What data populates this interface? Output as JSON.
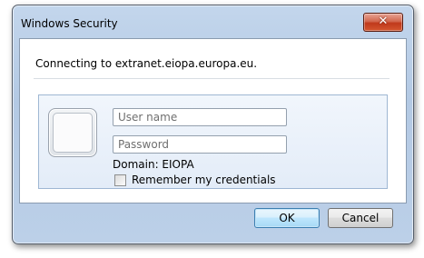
{
  "window": {
    "title": "Windows Security",
    "close_glyph": "✕"
  },
  "message": "Connecting to extranet.eiopa.europa.eu.",
  "credentials": {
    "username_placeholder": "User name",
    "password_placeholder": "Password",
    "domain_text": "Domain: EIOPA",
    "remember_label": "Remember my credentials",
    "remember_checked": false
  },
  "buttons": {
    "ok_label": "OK",
    "cancel_label": "Cancel"
  },
  "icons": {
    "user_tile": "user-tile-icon",
    "close": "close-icon"
  },
  "colors": {
    "frame": "#b3c9e4",
    "close_button": "#c0391c",
    "panel": "#e3ecf8",
    "default_button": "#bee6fd"
  }
}
